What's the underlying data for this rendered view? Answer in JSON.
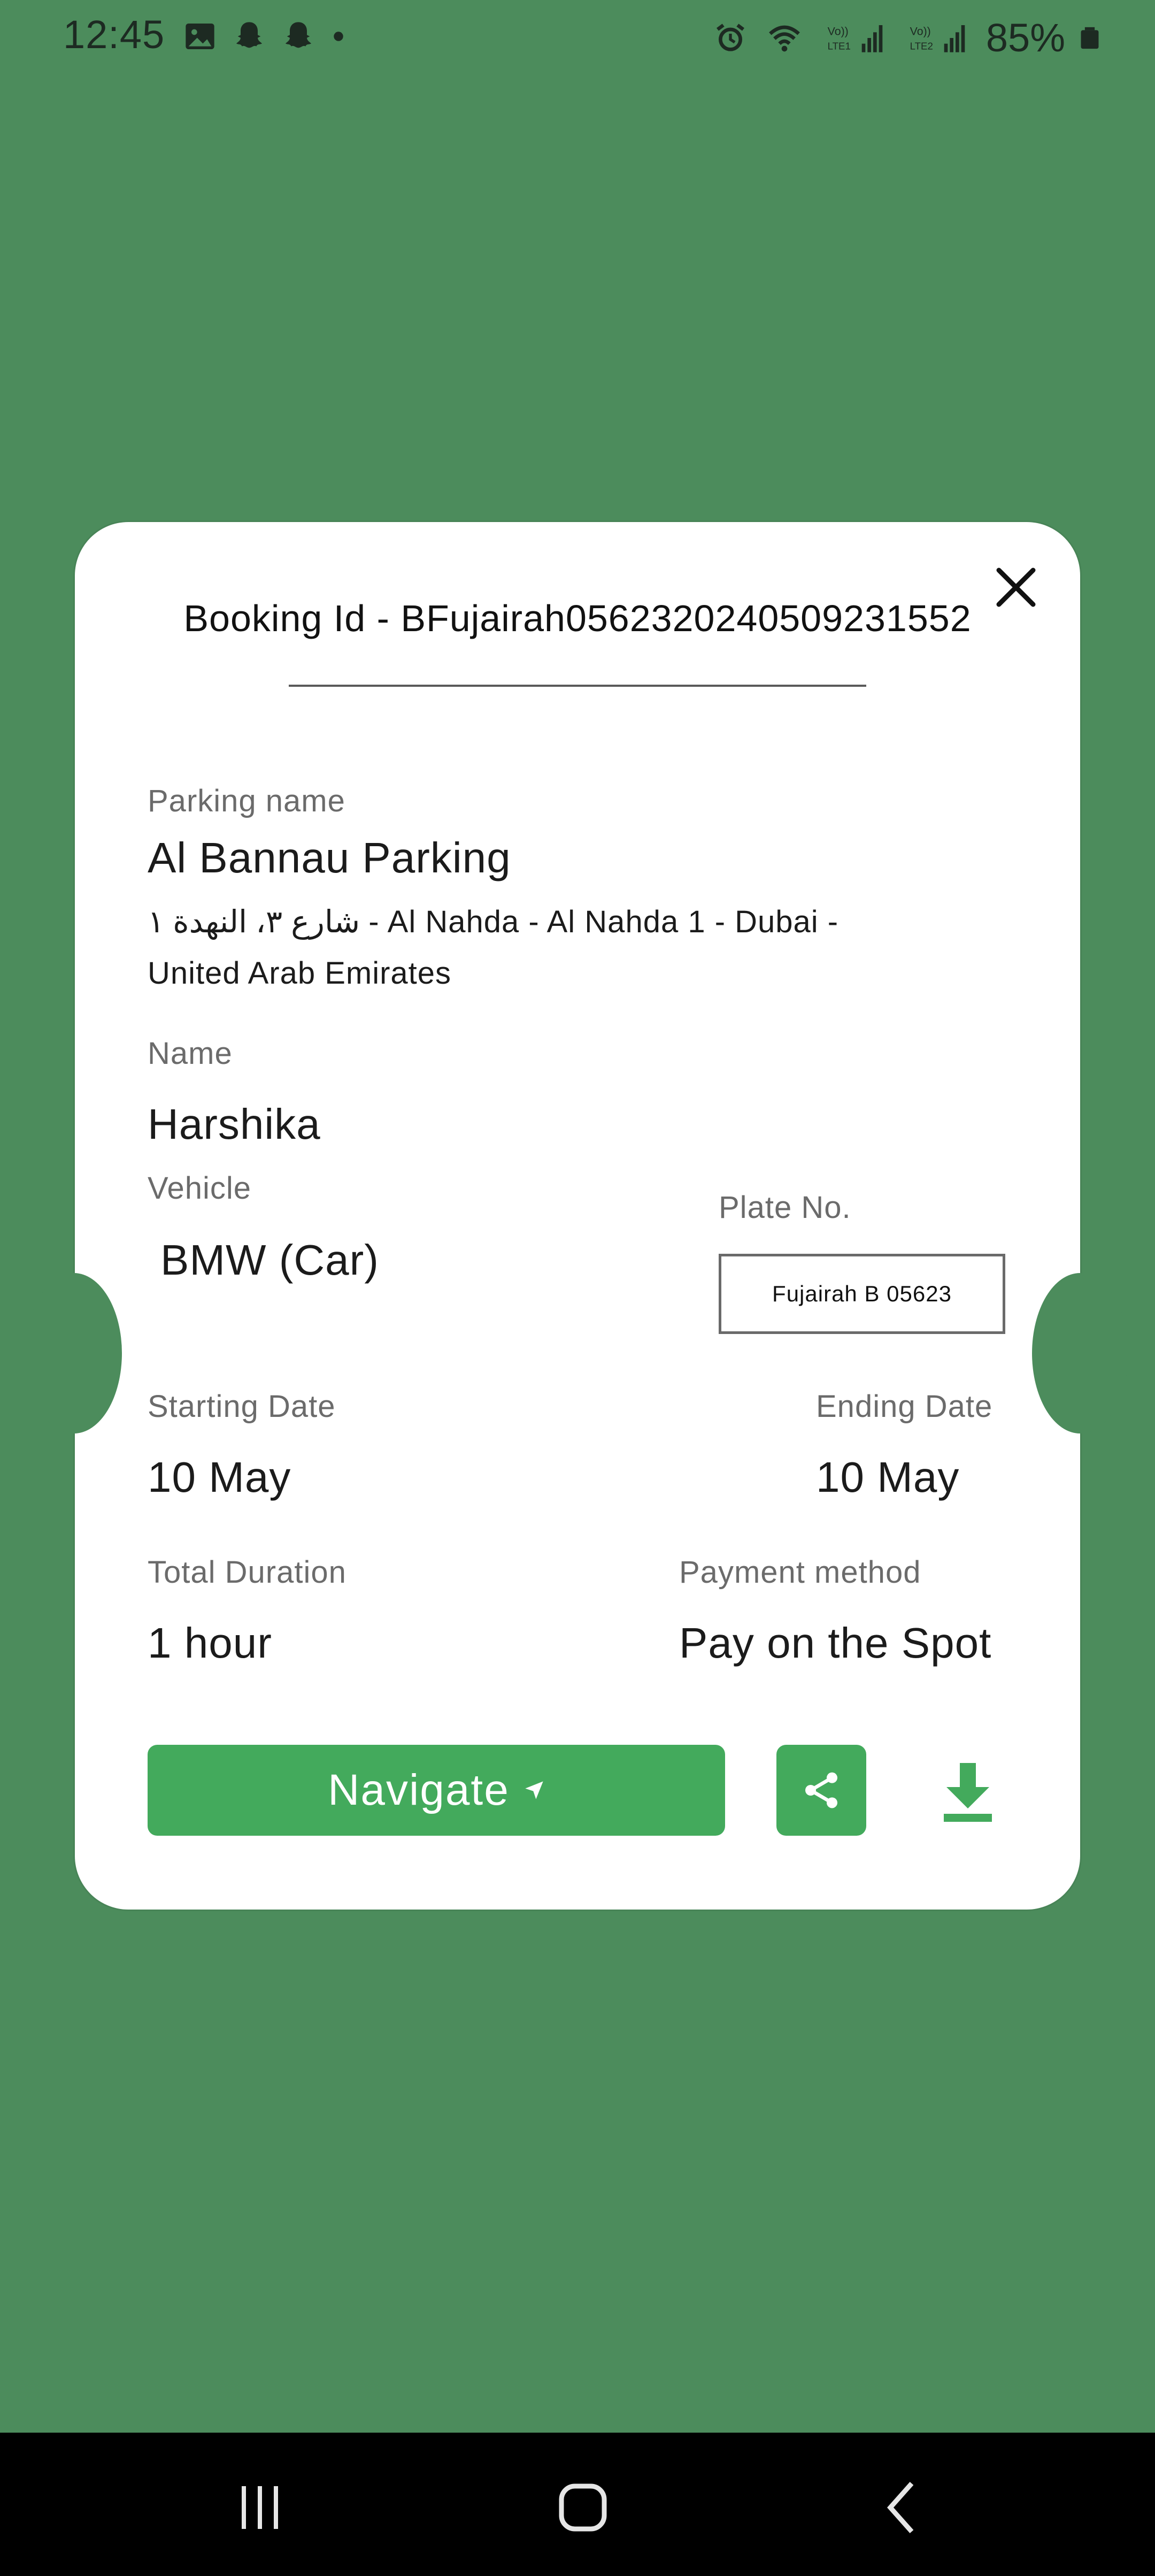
{
  "status_bar": {
    "time": "12:45",
    "battery": "85%",
    "left_icons": [
      "gallery-icon",
      "snapchat-icon",
      "snapchat-icon",
      "dot-icon"
    ],
    "right_icons": [
      "alarm-icon",
      "wifi-icon",
      "signal-lte1-icon",
      "signal-lte2-icon",
      "battery-icon"
    ]
  },
  "ticket": {
    "booking_id": "Booking Id - BFujairah0562320240509231552",
    "parking_name_label": "Parking name",
    "parking_name": "Al Bannau Parking",
    "address_line1": "شارع ٣، النهدة ١ - Al Nahda - Al Nahda 1 - Dubai -",
    "address_line2": "United Arab Emirates",
    "name_label": "Name",
    "name": "Harshika",
    "vehicle_label": "Vehicle",
    "vehicle": "BMW (Car)",
    "plate_label": "Plate No.",
    "plate": "Fujairah B 05623",
    "start_label": "Starting Date",
    "start": "10 May",
    "end_label": "Ending Date",
    "end": "10 May",
    "duration_label": "Total Duration",
    "duration": "1 hour",
    "payment_label": "Payment method",
    "payment": "Pay on the Spot",
    "navigate_label": "Navigate"
  },
  "colors": {
    "background": "#4c8c5c",
    "accent": "#43aa5c",
    "card": "#ffffff"
  }
}
